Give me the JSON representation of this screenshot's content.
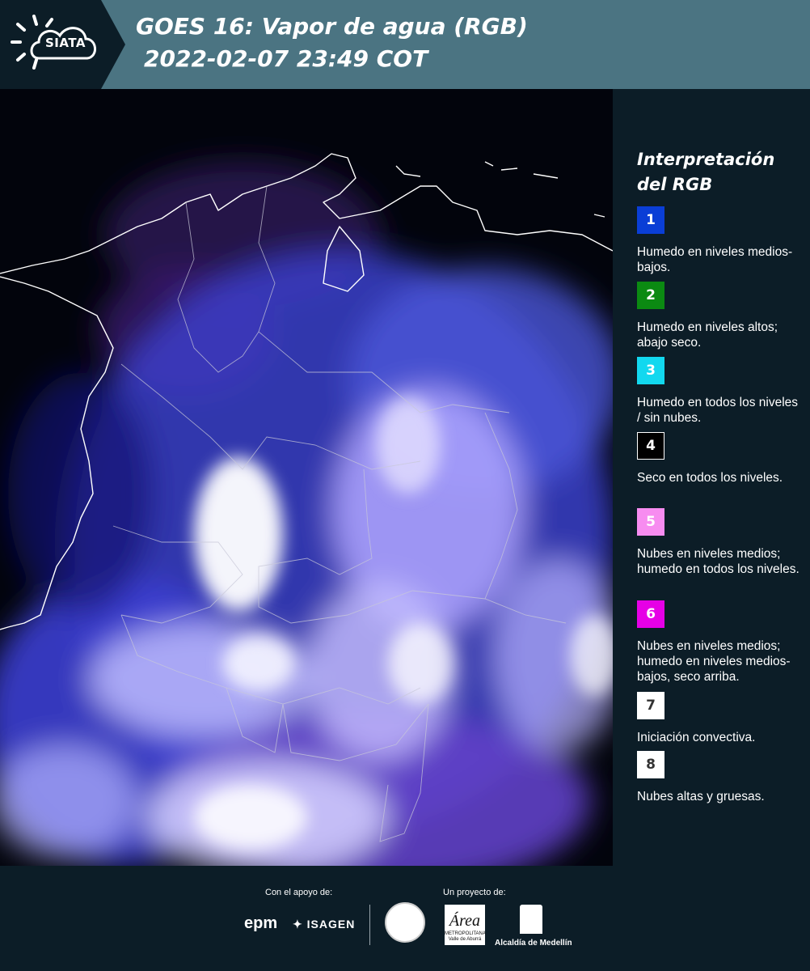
{
  "header": {
    "logo_text": "SIATA",
    "title_line1": "GOES 16: Vapor de agua (RGB)",
    "title_line2": "2022-02-07 23:49 COT",
    "background_color": "#4b7482"
  },
  "legend": {
    "title": "Interpretación del RGB",
    "items": [
      {
        "num": "1",
        "color": "#0a3ed6",
        "text_color": "#ffffff",
        "text": "Humedo en niveles medios-bajos."
      },
      {
        "num": "2",
        "color": "#0b8a12",
        "text_color": "#ffffff",
        "text": "Humedo en niveles altos; abajo seco."
      },
      {
        "num": "3",
        "color": "#12d8ef",
        "text_color": "#ffffff",
        "text": "Humedo en todos los niveles / sin nubes."
      },
      {
        "num": "4",
        "color": "#000000",
        "text_color": "#ffffff",
        "text": "Seco en todos los niveles."
      },
      {
        "num": "5",
        "color": "#f78cf0",
        "text_color": "#ffffff",
        "text": "Nubes en niveles medios; humedo en todos los niveles."
      },
      {
        "num": "6",
        "color": "#e600e6",
        "text_color": "#ffffff",
        "text": "Nubes en niveles medios; humedo en niveles medios-bajos, seco arriba."
      },
      {
        "num": "7",
        "color": "#ffffff",
        "text_color": "#333333",
        "text": "Iniciación convectiva."
      },
      {
        "num": "8",
        "color": "#ffffff",
        "text_color": "#333333",
        "text": "Nubes altas y gruesas."
      }
    ]
  },
  "footer": {
    "support_label": "Con el apoyo de:",
    "project_label": "Un proyecto de:",
    "epm": "epm",
    "isagen": "ISAGEN",
    "area_logo": "Área",
    "area_sub": "METROPOLITANA Valle de Aburrá",
    "alcaldia": "Alcaldía de Medellín"
  }
}
